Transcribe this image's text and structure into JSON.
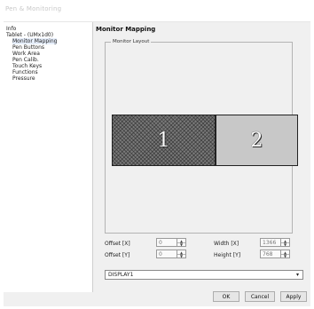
{
  "window": {
    "title": "Pen & Monitoring"
  },
  "sidebar": {
    "items": [
      {
        "label": "Info"
      },
      {
        "label": "Tablet - (UMx1d0)"
      },
      {
        "label": "Monitor Mapping"
      },
      {
        "label": "Pen Buttons"
      },
      {
        "label": "Work Area"
      },
      {
        "label": "Pen Calib."
      },
      {
        "label": "Touch Keys"
      },
      {
        "label": "Functions"
      },
      {
        "label": "Pressure"
      }
    ]
  },
  "main": {
    "heading": "Monitor Mapping",
    "group_label": "Monitor Layout",
    "monitors": [
      {
        "label": "1"
      },
      {
        "label": "2"
      }
    ],
    "controls": {
      "offset_x_label": "Offset [X]",
      "offset_x_value": "0",
      "offset_y_label": "Offset [Y]",
      "offset_y_value": "0",
      "width_label": "Width [X]",
      "width_value": "1366",
      "height_label": "Height [Y]",
      "height_value": "768"
    },
    "display_select": {
      "value": "DISPLAY1"
    }
  },
  "buttons": {
    "ok": "OK",
    "cancel": "Cancel",
    "apply": "Apply"
  },
  "icons": {
    "spin_up": "up-arrow-icon",
    "spin_down": "down-arrow-icon",
    "dropdown": "chevron-down-icon"
  }
}
